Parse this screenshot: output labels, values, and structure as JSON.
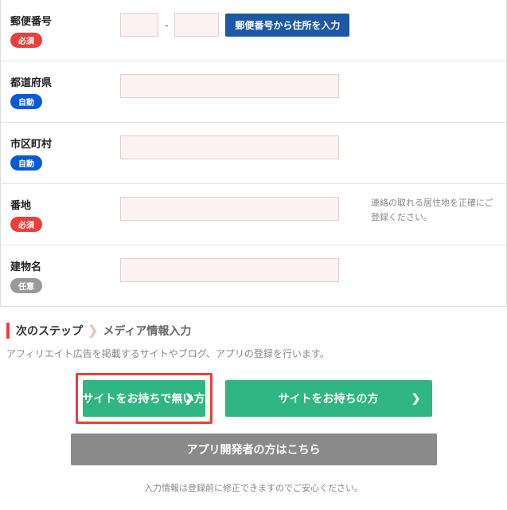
{
  "badges": {
    "required": "必須",
    "auto": "自動",
    "optional": "任意"
  },
  "form": {
    "postal": {
      "label": "郵便番号",
      "dash": "-",
      "button": "郵便番号から住所を入力"
    },
    "prefecture": {
      "label": "都道府県"
    },
    "city": {
      "label": "市区町村"
    },
    "street": {
      "label": "番地",
      "hint": "連絡の取れる居住地を正確にご登録ください。"
    },
    "building": {
      "label": "建物名"
    }
  },
  "next": {
    "step_label": "次のステップ",
    "sub_label": "メディア情報入力",
    "description": "アフィリエイト広告を掲載するサイトやブログ、アプリの登録を行います。",
    "btn_no_site": "サイトをお持ちで無い方",
    "btn_have_site": "サイトをお持ちの方",
    "btn_app_dev": "アプリ開発者の方はこちら",
    "footer_note": "入力情報は登録前に修正できますのでご安心ください。"
  }
}
